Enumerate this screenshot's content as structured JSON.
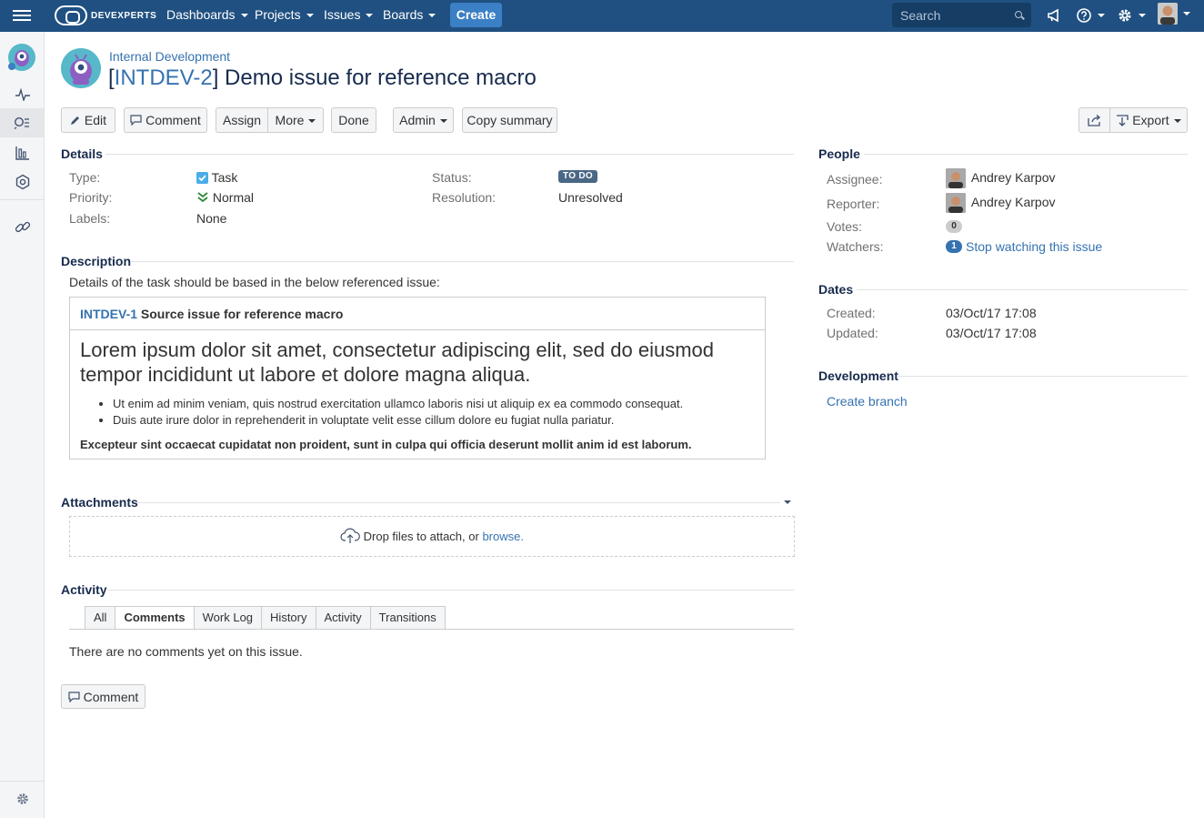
{
  "topnav": {
    "brand": "DEVEXPERTS",
    "menu": [
      {
        "label": "Dashboards"
      },
      {
        "label": "Projects"
      },
      {
        "label": "Issues"
      },
      {
        "label": "Boards"
      }
    ],
    "create_label": "Create",
    "search_placeholder": "Search"
  },
  "issue": {
    "project": "Internal Development",
    "key": "INTDEV-2",
    "summary": "Demo issue for reference macro"
  },
  "toolbar": {
    "edit": "Edit",
    "comment": "Comment",
    "assign": "Assign",
    "more": "More",
    "done": "Done",
    "admin": "Admin",
    "copy_summary": "Copy summary",
    "export": "Export"
  },
  "details": {
    "heading": "Details",
    "type_label": "Type:",
    "type_value": "Task",
    "priority_label": "Priority:",
    "priority_value": "Normal",
    "labels_label": "Labels:",
    "labels_value": "None",
    "status_label": "Status:",
    "status_value": "TO DO",
    "resolution_label": "Resolution:",
    "resolution_value": "Unresolved"
  },
  "description": {
    "heading": "Description",
    "intro": "Details of the task should be based in the below referenced issue:",
    "ref_key": "INTDEV-1",
    "ref_title": "Source issue for reference macro",
    "lead_line1": "Lorem ipsum dolor sit amet, consectetur adipiscing elit, sed do eiusmod",
    "lead_line2": "tempor incididunt ut labore et dolore magna aliqua.",
    "bullets": [
      "Ut enim ad minim veniam, quis nostrud exercitation ullamco laboris nisi ut aliquip ex ea commodo consequat.",
      "Duis aute irure dolor in reprehenderit in voluptate velit esse cillum dolore eu fugiat nulla pariatur."
    ],
    "bold_line": "Excepteur sint occaecat cupidatat non proident, sunt in culpa qui officia deserunt mollit anim id est laborum."
  },
  "attachments": {
    "heading": "Attachments",
    "drop_text": "Drop files to attach, or",
    "browse": "browse."
  },
  "activity": {
    "heading": "Activity",
    "tabs": [
      {
        "label": "All"
      },
      {
        "label": "Comments"
      },
      {
        "label": "Work Log"
      },
      {
        "label": "History"
      },
      {
        "label": "Activity"
      },
      {
        "label": "Transitions"
      }
    ],
    "empty": "There are no comments yet on this issue.",
    "comment_button": "Comment"
  },
  "people": {
    "heading": "People",
    "assignee_label": "Assignee:",
    "assignee": "Andrey Karpov",
    "reporter_label": "Reporter:",
    "reporter": "Andrey Karpov",
    "votes_label": "Votes:",
    "votes": "0",
    "watchers_label": "Watchers:",
    "watchers": "1",
    "watch_link": "Stop watching this issue"
  },
  "dates": {
    "heading": "Dates",
    "created_label": "Created:",
    "created": "03/Oct/17 17:08",
    "updated_label": "Updated:",
    "updated": "03/Oct/17 17:08"
  },
  "development": {
    "heading": "Development",
    "create_branch": "Create branch"
  },
  "colors": {
    "topbar": "#205081",
    "link": "#3572b0",
    "status": "#4a6785"
  }
}
